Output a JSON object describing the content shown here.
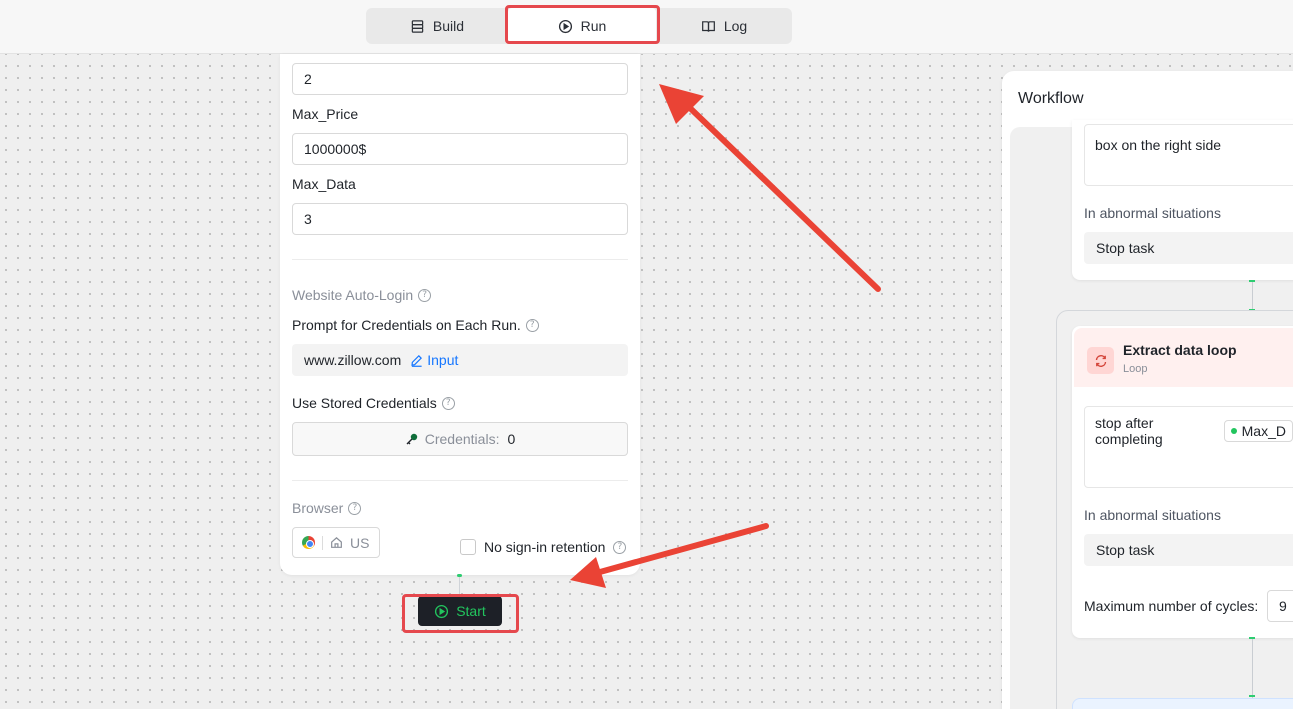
{
  "tabs": {
    "build": "Build",
    "run": "Run",
    "log": "Log"
  },
  "form": {
    "first_value": "2",
    "max_price_label": "Max_Price",
    "max_price_value": "1000000$",
    "max_data_label": "Max_Data",
    "max_data_value": "3",
    "auto_login_title": "Website Auto-Login",
    "prompt_credentials_label": "Prompt for Credentials on Each Run.",
    "site": "www.zillow.com",
    "input_link": "Input",
    "stored_credentials_label": "Use Stored Credentials",
    "credentials_label": "Credentials:",
    "credentials_count": "0",
    "browser_title": "Browser",
    "browser_region": "US",
    "no_signin_label": "No sign-in retention"
  },
  "start": {
    "label": "Start"
  },
  "workflow": {
    "title": "Workflow",
    "card1_desc": "box on the right side",
    "card1_abnormal_label": "In abnormal situations",
    "card1_abnormal_value": "Stop task",
    "loop_title": "Extract data loop",
    "loop_subtitle": "Loop",
    "loop_desc": "stop after completing",
    "loop_chip": "Max_D",
    "loop_abnormal_label": "In abnormal situations",
    "loop_abnormal_value": "Stop task",
    "max_cycles_label": "Maximum number of cycles:",
    "max_cycles_value": "9"
  },
  "colors": {
    "highlight": "#e5484d",
    "start_text": "#22c55e",
    "link": "#1677ff"
  }
}
